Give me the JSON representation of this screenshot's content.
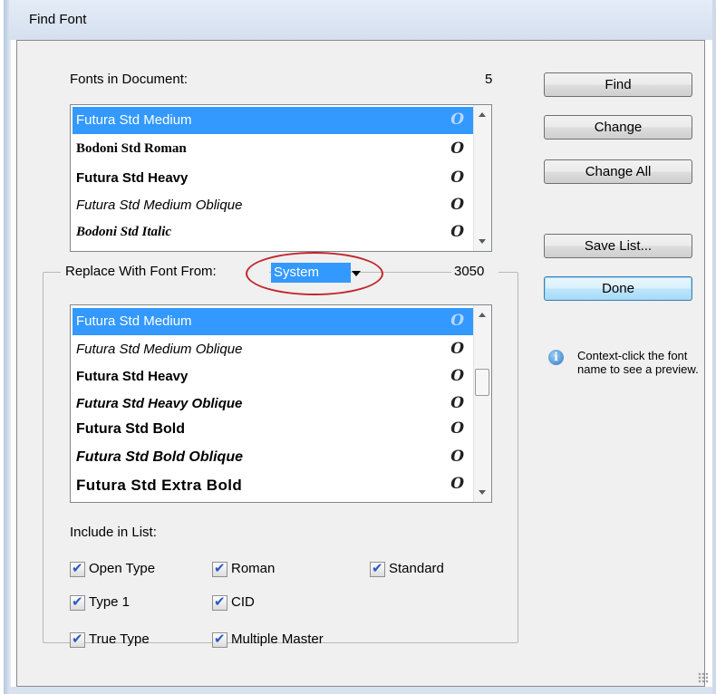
{
  "window": {
    "title": "Find Font"
  },
  "fonts_in_document": {
    "label": "Fonts in Document:",
    "count": "5",
    "items": [
      {
        "name": "Futura Std Medium",
        "icon": "opentype-icon",
        "glyph": "O",
        "selected": true
      },
      {
        "name": "Bodoni Std Roman",
        "icon": "opentype-icon",
        "glyph": "O",
        "selected": false
      },
      {
        "name": "Futura Std Heavy",
        "icon": "opentype-icon",
        "glyph": "O",
        "selected": false
      },
      {
        "name": "Futura Std Medium Oblique",
        "icon": "opentype-icon",
        "glyph": "O",
        "selected": false
      },
      {
        "name": "Bodoni Std Italic",
        "icon": "opentype-icon",
        "glyph": "O",
        "selected": false
      }
    ]
  },
  "replace": {
    "label": "Replace With Font From:",
    "source_value": "System",
    "count": "3050",
    "items": [
      {
        "name": "Futura Std Medium",
        "icon": "opentype-icon",
        "glyph": "O",
        "selected": true
      },
      {
        "name": "Futura Std Medium Oblique",
        "icon": "opentype-icon",
        "glyph": "O",
        "selected": false
      },
      {
        "name": "Futura Std Heavy",
        "icon": "opentype-icon",
        "glyph": "O",
        "selected": false
      },
      {
        "name": "Futura Std Heavy Oblique",
        "icon": "opentype-icon",
        "glyph": "O",
        "selected": false
      },
      {
        "name": "Futura Std Bold",
        "icon": "opentype-icon",
        "glyph": "O",
        "selected": false
      },
      {
        "name": "Futura Std Bold Oblique",
        "icon": "opentype-icon",
        "glyph": "O",
        "selected": false
      },
      {
        "name": "Futura Std Extra Bold",
        "icon": "opentype-icon",
        "glyph": "O",
        "selected": false
      }
    ]
  },
  "include": {
    "label": "Include in List:",
    "options": {
      "open_type": {
        "label": "Open Type",
        "checked": true
      },
      "roman": {
        "label": "Roman",
        "checked": true
      },
      "standard": {
        "label": "Standard",
        "checked": true
      },
      "type1": {
        "label": "Type 1",
        "checked": true
      },
      "cid": {
        "label": "CID",
        "checked": true
      },
      "true_type": {
        "label": "True Type",
        "checked": true
      },
      "multiple_master": {
        "label": "Multiple Master",
        "checked": true
      }
    }
  },
  "buttons": {
    "find": "Find",
    "change": "Change",
    "change_all": "Change All",
    "save_list": "Save List...",
    "done": "Done"
  },
  "hint": {
    "icon": "info-icon",
    "glyph": "i",
    "text": "Context-click the font name to see a preview."
  },
  "check_glyph": "✔",
  "colors": {
    "selection": "#3399ff",
    "annotation_ellipse": "#c0262d"
  }
}
